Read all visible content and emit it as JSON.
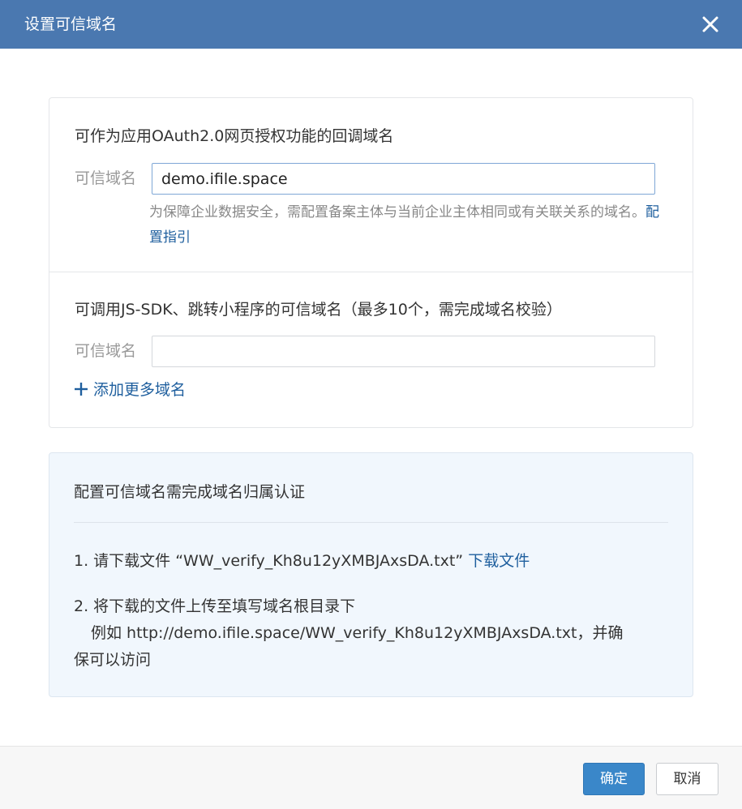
{
  "dialog": {
    "title": "设置可信域名",
    "close_icon": "close-icon"
  },
  "oauth_section": {
    "title": "可作为应用OAuth2.0网页授权功能的回调域名",
    "field_label": "可信域名",
    "field_value": "demo.ifile.space",
    "hint_text": "为保障企业数据安全，需配置备案主体与当前企业主体相同或有关联关系的域名。",
    "hint_link": "配置指引"
  },
  "jssdk_section": {
    "title": "可调用JS-SDK、跳转小程序的可信域名（最多10个，需完成域名校验）",
    "field_label": "可信域名",
    "field_value": "",
    "add_more": "添加更多域名",
    "add_icon": "plus-icon"
  },
  "verify_info": {
    "title": "配置可信域名需完成域名归属认证",
    "step1_text": "1. 请下载文件 “WW_verify_Kh8u12yXMBJAxsDA.txt”",
    "step1_link": "下载文件",
    "step2_line1": "2. 将下载的文件上传至填写域名根目录下",
    "step2_line2": "例如 http://demo.ifile.space/WW_verify_Kh8u12yXMBJAxsDA.txt，并确",
    "step2_line3": "保可以访问"
  },
  "footer": {
    "confirm_label": "确定",
    "cancel_label": "取消"
  },
  "colors": {
    "titlebar": "#4a78b0",
    "link": "#1f5f9e",
    "primary_button": "#3a87c9",
    "info_background": "#f1f7fd"
  }
}
